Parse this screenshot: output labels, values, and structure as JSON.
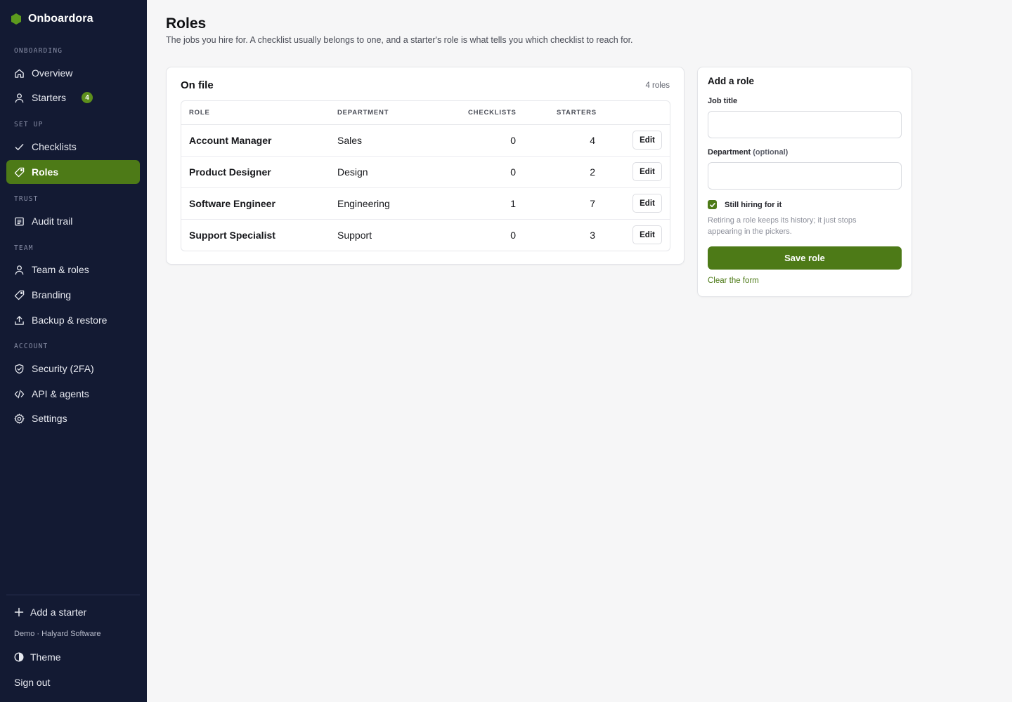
{
  "app": {
    "name": "Onboardora"
  },
  "sidebar": {
    "sections": [
      {
        "label": "ONBOARDING"
      },
      {
        "label": "SET UP"
      },
      {
        "label": "TRUST"
      },
      {
        "label": "TEAM"
      },
      {
        "label": "ACCOUNT"
      }
    ],
    "items": [
      {
        "label": "Overview",
        "icon": "home-icon"
      },
      {
        "label": "Starters",
        "icon": "person-icon",
        "badge": "4"
      },
      {
        "label": "Checklists",
        "icon": "check-icon"
      },
      {
        "label": "Roles",
        "icon": "tag-icon",
        "active": true
      },
      {
        "label": "Audit trail",
        "icon": "list-icon"
      },
      {
        "label": "Team & roles",
        "icon": "person-icon"
      },
      {
        "label": "Branding",
        "icon": "tag-icon"
      },
      {
        "label": "Backup & restore",
        "icon": "upload-icon"
      },
      {
        "label": "Security (2FA)",
        "icon": "shield-icon"
      },
      {
        "label": "API & agents",
        "icon": "code-icon"
      },
      {
        "label": "Settings",
        "icon": "gear-icon"
      }
    ],
    "footer": {
      "add_starter": "Add a starter",
      "workspace": "Demo · Halyard Software",
      "theme": "Theme",
      "sign_out": "Sign out"
    }
  },
  "page": {
    "title": "Roles",
    "subtitle": "The jobs you hire for. A checklist usually belongs to one, and a starter's role is what tells you which checklist to reach for."
  },
  "on_file": {
    "title": "On file",
    "count": "4 roles",
    "columns": {
      "role": "ROLE",
      "department": "DEPARTMENT",
      "checklists": "CHECKLISTS",
      "starters": "STARTERS"
    },
    "edit_label": "Edit",
    "rows": [
      {
        "role": "Account Manager",
        "department": "Sales",
        "checklists": "0",
        "starters": "4"
      },
      {
        "role": "Product Designer",
        "department": "Design",
        "checklists": "0",
        "starters": "2"
      },
      {
        "role": "Software Engineer",
        "department": "Engineering",
        "checklists": "1",
        "starters": "7"
      },
      {
        "role": "Support Specialist",
        "department": "Support",
        "checklists": "0",
        "starters": "3"
      }
    ]
  },
  "add_role": {
    "title": "Add a role",
    "job_title_label": "Job title",
    "job_title_value": "",
    "department_label": "Department",
    "department_optional": "(optional)",
    "department_value": "",
    "still_hiring_label": "Still hiring for it",
    "still_hiring_checked": true,
    "hint": "Retiring a role keeps its history; it just stops appearing in the pickers.",
    "save_label": "Save role",
    "clear_label": "Clear the form"
  },
  "colors": {
    "sidebar_bg": "#131a33",
    "accent": "#4d7a17",
    "page_bg": "#f6f6f7"
  }
}
